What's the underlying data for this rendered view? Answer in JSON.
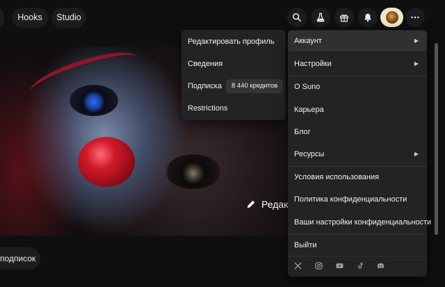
{
  "nav": {
    "tabs": [
      "Hooks",
      "Studio"
    ],
    "icons": [
      "search-icon",
      "flask-icon",
      "gift-icon",
      "bell-icon",
      "avatar",
      "more-icon"
    ]
  },
  "hero": {
    "edit_label": "Редак"
  },
  "subscriptions_chip": "подписок",
  "profile_menu": {
    "items": [
      {
        "label": "Редактировать профиль"
      },
      {
        "label": "Сведения"
      },
      {
        "label": "Подписка",
        "badge": "8 440 кредитов"
      },
      {
        "label": "Restrictions"
      }
    ]
  },
  "main_menu": {
    "items": [
      {
        "label": "Аккаунт",
        "submenu": true
      },
      {
        "label": "Настройки",
        "submenu": true
      },
      {
        "label": "О Suno"
      },
      {
        "label": "Карьера"
      },
      {
        "label": "Блог"
      },
      {
        "label": "Ресурсы",
        "submenu": true
      },
      {
        "label": "Условия использования"
      },
      {
        "label": "Политика конфиденциальности"
      },
      {
        "label": "Ваши настройки конфиденциальности"
      },
      {
        "label": "Выйти"
      }
    ],
    "socials": [
      "x-icon",
      "instagram-icon",
      "youtube-icon",
      "tiktok-icon",
      "discord-icon"
    ]
  },
  "colors": {
    "background": "#0f0f10",
    "menu_bg": "#232325",
    "menu_hover": "#303033",
    "pill_bg": "#1c1c1e",
    "avatar_ring": "#f3e6c8"
  }
}
